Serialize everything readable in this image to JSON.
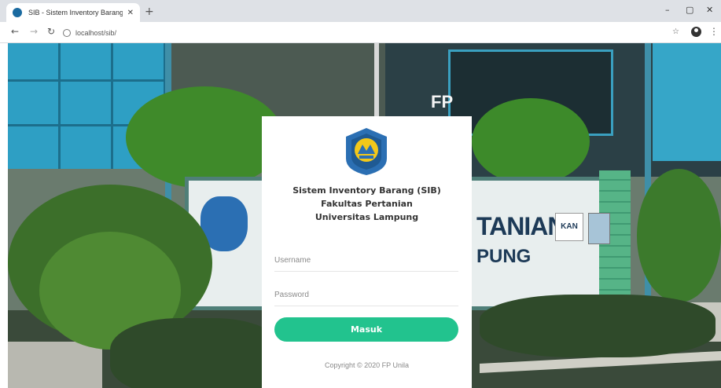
{
  "browser": {
    "tab_title": "SIB - Sistem Inventory Barang Fa",
    "tab_close": "✕",
    "new_tab": "+",
    "url": "localhost/sib/",
    "minimize": "–",
    "maximize": "▢",
    "close": "✕"
  },
  "scene": {
    "building_sign": "FP",
    "wall_text_1": "TANIAN",
    "wall_text_2": "PUNG",
    "kan_badge": "KAN"
  },
  "login": {
    "title_line1": "Sistem Inventory Barang (SIB)",
    "title_line2": "Fakultas Pertanian",
    "title_line3": "Universitas Lampung",
    "username_placeholder": "Username",
    "password_placeholder": "Password",
    "submit_label": "Masuk",
    "copyright": "Copyright © 2020 FP Unila"
  },
  "colors": {
    "accent": "#22c38e",
    "logo_blue": "#2b6fb3",
    "logo_yellow": "#f2c81a"
  }
}
